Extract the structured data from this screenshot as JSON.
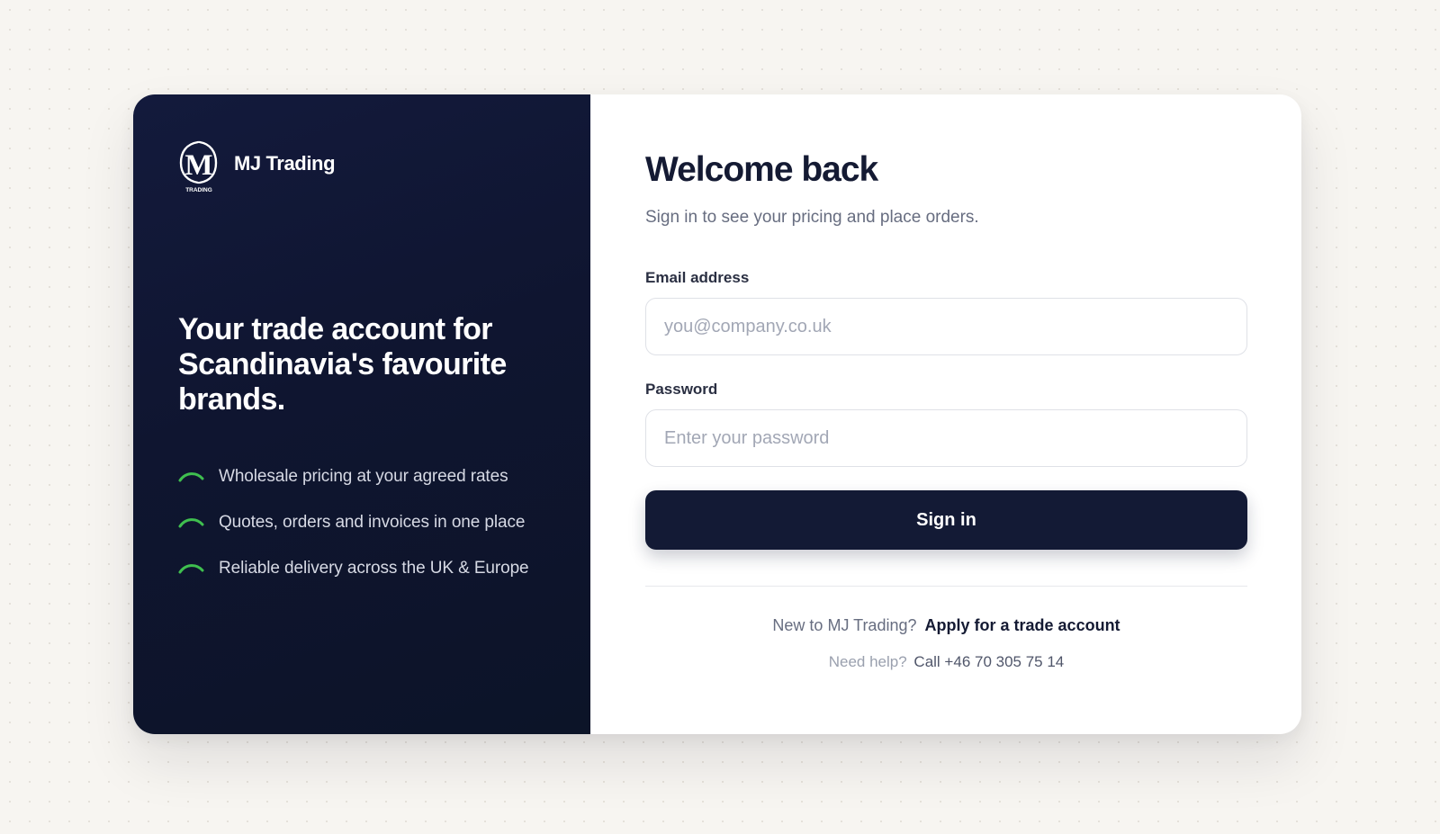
{
  "brand": {
    "logo_mark_letter": "M",
    "logo_mark_caption": "TRADING",
    "name": "MJ Trading",
    "accent_color": "#3fbf4f",
    "headline": "Your trade account for Scandinavia's favourite brands.",
    "features": [
      {
        "icon": "checkmark-icon",
        "label": "Wholesale pricing at your agreed rates"
      },
      {
        "icon": "checkmark-icon",
        "label": "Quotes, orders and invoices in one place"
      },
      {
        "icon": "checkmark-icon",
        "label": "Reliable delivery across the UK & Europe"
      }
    ]
  },
  "login": {
    "title": "Welcome back",
    "subtitle": "Sign in to see your pricing and place orders.",
    "email": {
      "label": "Email address",
      "placeholder": "you@company.co.uk",
      "value": ""
    },
    "password": {
      "label": "Password",
      "placeholder": "Enter your password",
      "value": ""
    },
    "submit_label": "Sign in",
    "signup_prompt": "New to MJ Trading?",
    "signup_link": "Apply for a trade account",
    "help_prompt": "Need help?",
    "help_phone": "Call +46 70 305 75 14"
  },
  "colors": {
    "panel_dark": "#0f1530",
    "button": "#131a35",
    "page_background": "#f7f5f1"
  }
}
